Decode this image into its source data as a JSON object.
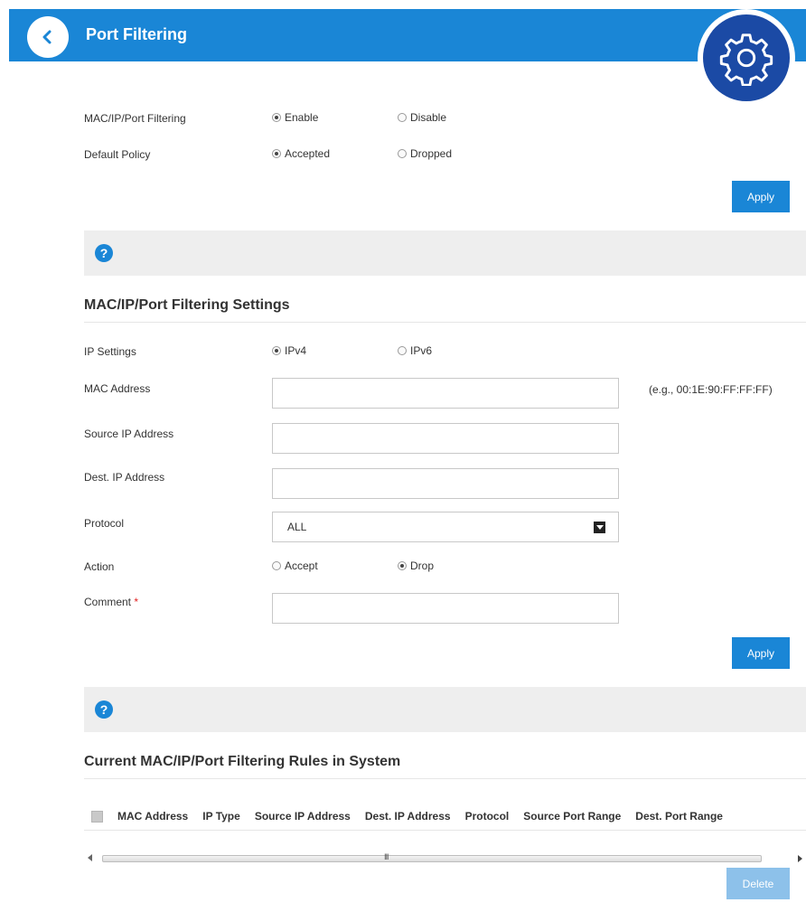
{
  "header": {
    "title": "Port Filtering",
    "back_icon": "chevron-left-icon",
    "settings_icon": "gear-icon"
  },
  "global": {
    "filtering_label": "MAC/IP/Port Filtering",
    "filtering_enable": "Enable",
    "filtering_disable": "Disable",
    "filtering_selected": "Enable",
    "policy_label": "Default Policy",
    "policy_accepted": "Accepted",
    "policy_dropped": "Dropped",
    "policy_selected": "Accepted",
    "apply_label": "Apply"
  },
  "settings": {
    "help_icon": "?",
    "title": "MAC/IP/Port Filtering Settings",
    "ip_settings_label": "IP Settings",
    "ipv4": "IPv4",
    "ipv6": "IPv6",
    "ip_selected": "IPv4",
    "mac_label": "MAC Address",
    "mac_value": "",
    "mac_hint": "(e.g., 00:1E:90:FF:FF:FF)",
    "source_ip_label": "Source IP Address",
    "source_ip_value": "",
    "dest_ip_label": "Dest. IP Address",
    "dest_ip_value": "",
    "protocol_label": "Protocol",
    "protocol_value": "ALL",
    "action_label": "Action",
    "action_accept": "Accept",
    "action_drop": "Drop",
    "action_selected": "Drop",
    "comment_label": "Comment",
    "comment_required": "*",
    "comment_value": "",
    "apply_label": "Apply"
  },
  "rules": {
    "help_icon": "?",
    "title": "Current MAC/IP/Port Filtering Rules in System",
    "columns": [
      "MAC Address",
      "IP Type",
      "Source IP Address",
      "Dest. IP Address",
      "Protocol",
      "Source Port Range",
      "Dest. Port Range"
    ],
    "scroll_grip": "III",
    "delete_label": "Delete"
  },
  "colors": {
    "accent": "#1a86d6",
    "gear_badge": "#1b4aa5",
    "help_bar": "#eeeeee"
  }
}
